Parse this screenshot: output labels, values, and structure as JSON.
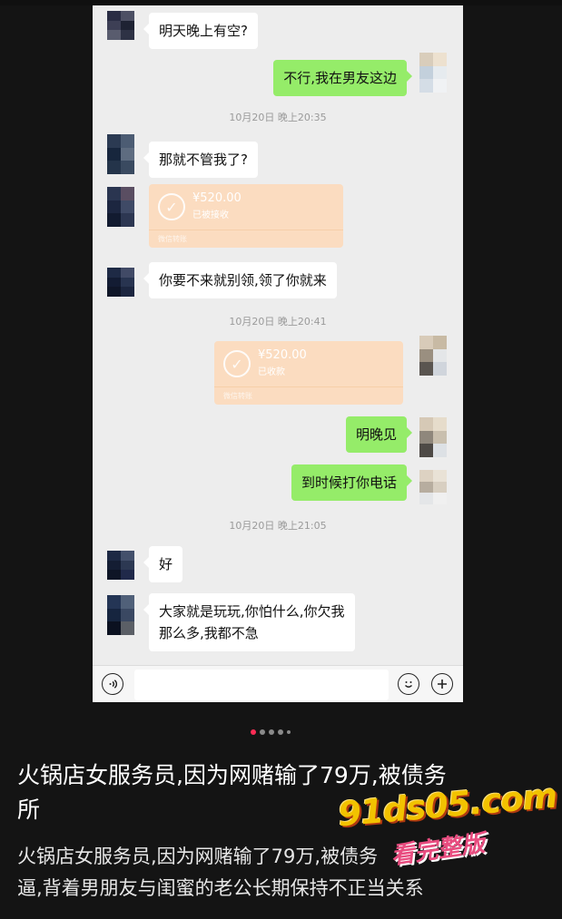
{
  "chat": {
    "messages": [
      {
        "side": "in",
        "text": "明天晚上有空?"
      },
      {
        "side": "out",
        "text": "不行,我在男友这边"
      },
      {
        "timestamp": "10月20日 晚上20:35"
      },
      {
        "side": "in",
        "text": "那就不管我了?"
      },
      {
        "side": "in",
        "type": "transfer",
        "amount": "¥520.00",
        "status": "已被接收",
        "footer": "微信转账"
      },
      {
        "side": "in",
        "text": "你要不来就别领,领了你就来"
      },
      {
        "timestamp": "10月20日 晚上20:41"
      },
      {
        "side": "out",
        "type": "transfer",
        "amount": "¥520.00",
        "status": "已收款",
        "footer": "微信转账"
      },
      {
        "side": "out",
        "text": "明晚见"
      },
      {
        "side": "out",
        "text": "到时候打你电话"
      },
      {
        "timestamp": "10月20日 晚上21:05"
      },
      {
        "side": "in",
        "text": "好"
      },
      {
        "side": "in",
        "text": "大家就是玩玩,你怕什么,你欠我那么多,我都不急",
        "lines": [
          "大家就是玩玩,你怕什么,你欠我",
          "那么多,我都不急"
        ]
      }
    ]
  },
  "icons": {
    "voice": "voice-icon",
    "emoji": "emoji-icon",
    "add": "plus-icon"
  },
  "carousel": {
    "count": 5,
    "active_index": 0
  },
  "post": {
    "title_lines": [
      "火锅店女服务员,因为网赌输了79万,被债务",
      "所"
    ],
    "desc_lines": [
      "火锅店女服务员,因为网赌输了79万,被债务",
      "逼,背着男朋友与闺蜜的老公长期保持不正当关系"
    ]
  },
  "watermark": {
    "main": "91ds05.com",
    "sub": "看完整版"
  },
  "colors": {
    "outgoing_bubble": "#95ec69",
    "transfer_card": "#fbdcc0",
    "chat_bg": "#ededed",
    "active_dot": "#fe2c55",
    "page_bg": "#141414"
  }
}
